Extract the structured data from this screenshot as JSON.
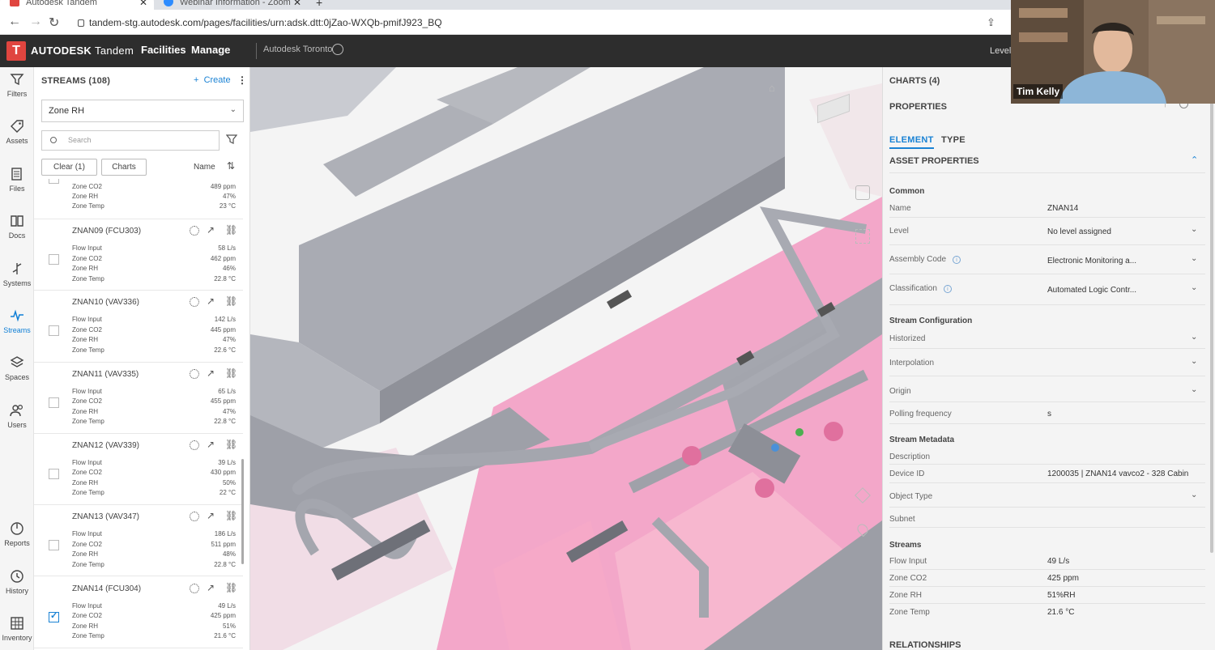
{
  "browser": {
    "tabs": [
      {
        "label": "Autodesk Tandem",
        "active": true,
        "fav_color": "#e0453f"
      },
      {
        "label": "Webinar Information - Zoom",
        "active": false,
        "fav_color": "#2d8cff"
      }
    ],
    "new_tab": "+",
    "url": "tandem-stg.autodesk.com/pages/facilities/urn:adsk.dtt:0jZao-WXQb-pmifJ923_BQ"
  },
  "appbar": {
    "logo_letter": "T",
    "brand_bold": "AUTODESK",
    "brand_rest": "Tandem",
    "menu": [
      "Facilities",
      "Manage"
    ],
    "facility": "Autodesk Toronto",
    "level_label": "Level"
  },
  "leftnav": [
    {
      "label": "Filters",
      "icon": "filter-icon",
      "active": false
    },
    {
      "label": "Assets",
      "icon": "tag-icon",
      "active": false
    },
    {
      "label": "Files",
      "icon": "files-icon",
      "active": false
    },
    {
      "label": "Docs",
      "icon": "book-icon",
      "active": false
    },
    {
      "label": "Systems",
      "icon": "systems-icon",
      "active": false
    },
    {
      "label": "Streams",
      "icon": "pulse-icon",
      "active": true
    },
    {
      "label": "Spaces",
      "icon": "layers-icon",
      "active": false
    },
    {
      "label": "Users",
      "icon": "users-icon",
      "active": false
    },
    {
      "label": "Reports",
      "icon": "gauge-icon",
      "active": false
    },
    {
      "label": "History",
      "icon": "history-icon",
      "active": false
    },
    {
      "label": "Inventory",
      "icon": "grid-icon",
      "active": false
    }
  ],
  "streams": {
    "title": "STREAMS (108)",
    "create_label": "Create",
    "dropdown_value": "Zone RH",
    "search_placeholder": "Search",
    "clear_label": "Clear (1)",
    "charts_label": "Charts",
    "sort_label": "Name",
    "partial_item": {
      "rows": [
        {
          "label": "Zone CO2",
          "value": "489 ppm"
        },
        {
          "label": "Zone RH",
          "value": "47%"
        },
        {
          "label": "Zone Temp",
          "value": "23 °C"
        }
      ]
    },
    "items": [
      {
        "name": "ZNAN09 (FCU303)",
        "checked": false,
        "rows": [
          {
            "label": "Flow Input",
            "value": "58 L/s"
          },
          {
            "label": "Zone CO2",
            "value": "462 ppm"
          },
          {
            "label": "Zone RH",
            "value": "46%"
          },
          {
            "label": "Zone Temp",
            "value": "22.8 °C"
          }
        ]
      },
      {
        "name": "ZNAN10 (VAV336)",
        "checked": false,
        "rows": [
          {
            "label": "Flow Input",
            "value": "142 L/s"
          },
          {
            "label": "Zone CO2",
            "value": "445 ppm"
          },
          {
            "label": "Zone RH",
            "value": "47%"
          },
          {
            "label": "Zone Temp",
            "value": "22.6 °C"
          }
        ]
      },
      {
        "name": "ZNAN11 (VAV335)",
        "checked": false,
        "rows": [
          {
            "label": "Flow Input",
            "value": "65 L/s"
          },
          {
            "label": "Zone CO2",
            "value": "455 ppm"
          },
          {
            "label": "Zone RH",
            "value": "47%"
          },
          {
            "label": "Zone Temp",
            "value": "22.8 °C"
          }
        ]
      },
      {
        "name": "ZNAN12 (VAV339)",
        "checked": false,
        "rows": [
          {
            "label": "Flow Input",
            "value": "39 L/s"
          },
          {
            "label": "Zone CO2",
            "value": "430 ppm"
          },
          {
            "label": "Zone RH",
            "value": "50%"
          },
          {
            "label": "Zone Temp",
            "value": "22 °C"
          }
        ]
      },
      {
        "name": "ZNAN13 (VAV347)",
        "checked": false,
        "rows": [
          {
            "label": "Flow Input",
            "value": "186 L/s"
          },
          {
            "label": "Zone CO2",
            "value": "511 ppm"
          },
          {
            "label": "Zone RH",
            "value": "48%"
          },
          {
            "label": "Zone Temp",
            "value": "22.8 °C"
          }
        ]
      },
      {
        "name": "ZNAN14 (FCU304)",
        "checked": true,
        "rows": [
          {
            "label": "Flow Input",
            "value": "49 L/s"
          },
          {
            "label": "Zone CO2",
            "value": "425 ppm"
          },
          {
            "label": "Zone RH",
            "value": "51%"
          },
          {
            "label": "Zone Temp",
            "value": "21.6 °C"
          }
        ]
      }
    ]
  },
  "properties": {
    "charts_title": "CHARTS (4)",
    "title": "PROPERTIES",
    "tabs": [
      {
        "label": "ELEMENT",
        "active": true
      },
      {
        "label": "TYPE",
        "active": false
      }
    ],
    "asset_section": "ASSET PROPERTIES",
    "common_group": "Common",
    "name_label": "Name",
    "name_value": "ZNAN14",
    "level_label": "Level",
    "level_value": "No level assigned",
    "assembly_label": "Assembly Code",
    "assembly_value": "Electronic Monitoring a...",
    "classification_label": "Classification",
    "classification_value": "Automated Logic Contr...",
    "stream_config_group": "Stream Configuration",
    "historized_label": "Historized",
    "interpolation_label": "Interpolation",
    "origin_label": "Origin",
    "polling_label": "Polling frequency",
    "polling_value": "s",
    "metadata_group": "Stream Metadata",
    "description_label": "Description",
    "device_id_label": "Device ID",
    "device_id_value": "1200035 | ZNAN14 vavco2 - 328 Cabin",
    "object_type_label": "Object Type",
    "subnet_label": "Subnet",
    "streams_group": "Streams",
    "flow_label": "Flow Input",
    "flow_value": "49 L/s",
    "co2_label": "Zone CO2",
    "co2_value": "425 ppm",
    "rh_label": "Zone RH",
    "rh_value": "51%RH",
    "temp_label": "Zone Temp",
    "temp_value": "21.6 °C",
    "relationships_section": "RELATIONSHIPS"
  },
  "video": {
    "participant_name": "Tim Kelly"
  },
  "colors": {
    "accent": "#1a82d4",
    "brand_red": "#e0453f",
    "zone_pink": "#f39ec4",
    "duct_gray": "#a9abb3"
  }
}
